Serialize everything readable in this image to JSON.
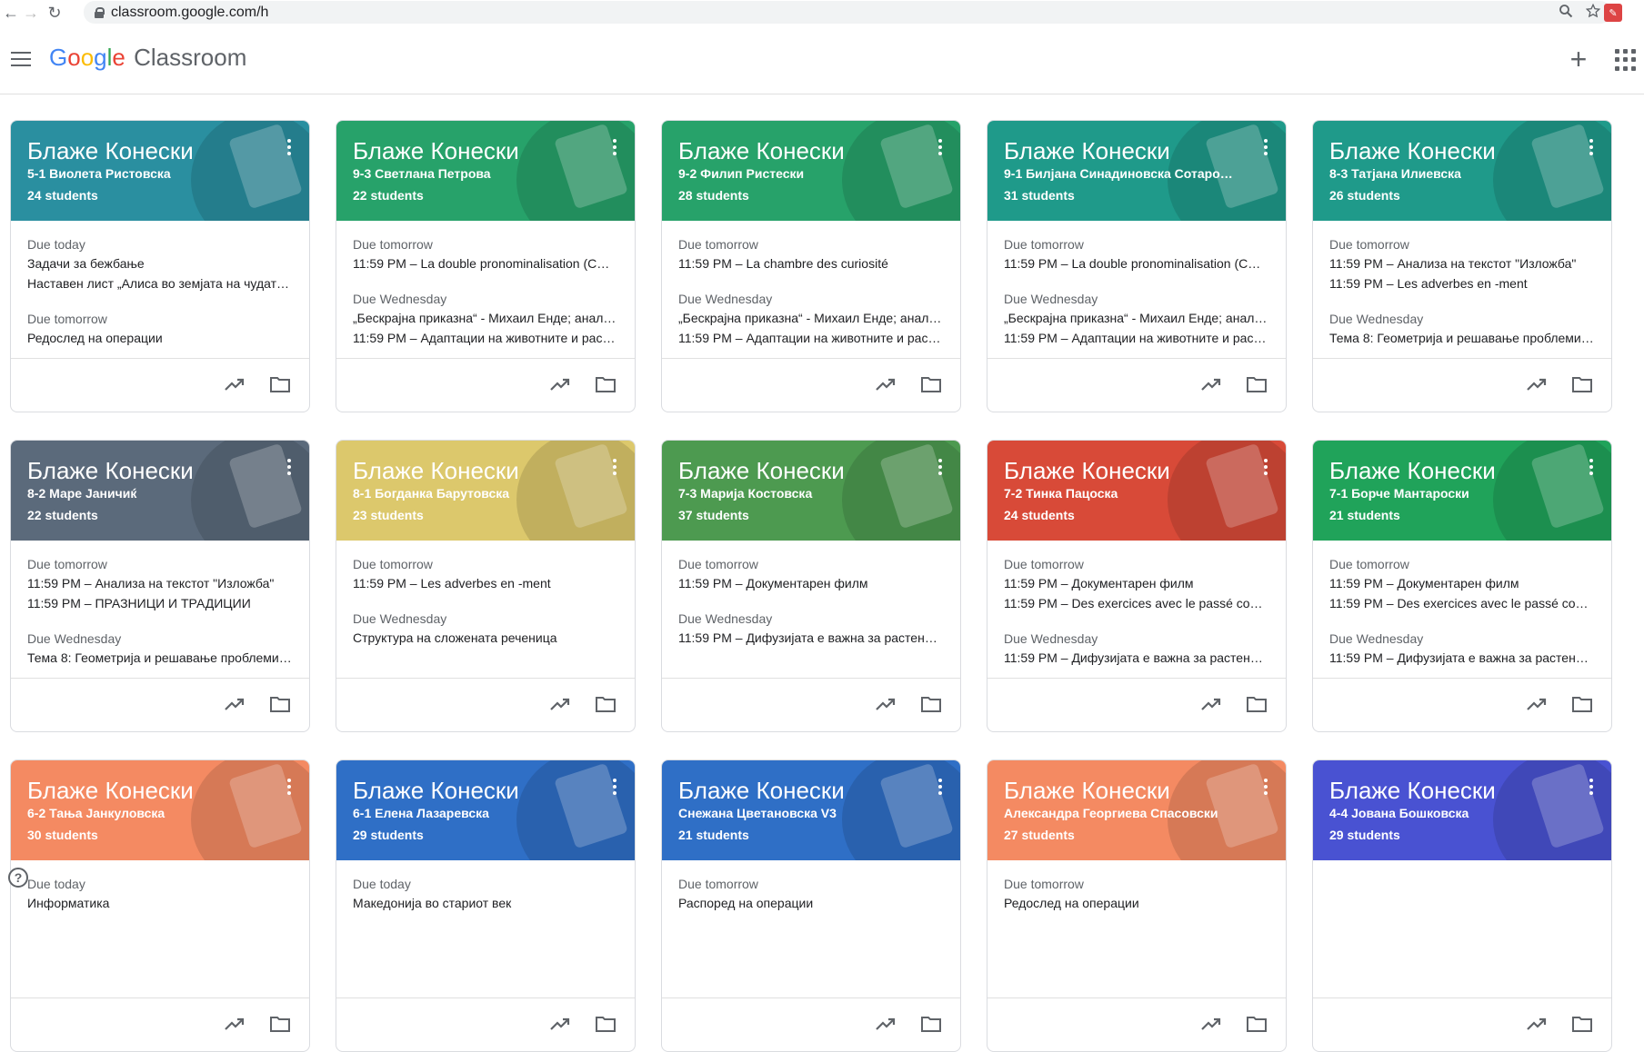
{
  "browser": {
    "url": "classroom.google.com/h"
  },
  "header": {
    "logo_google_letters": [
      "G",
      "o",
      "o",
      "g",
      "l",
      "e"
    ],
    "logo_product": "Classroom"
  },
  "colors": {
    "teal": "#1e8fa0",
    "green": "#24a268",
    "slate": "#5a6c7e",
    "yellow": "#dec86a",
    "leaf": "#4a9a4c",
    "red": "#d84c3a",
    "emerald": "#1ea55f",
    "orange": "#f48a61",
    "blue": "#3271c8",
    "indigo": "#4a55d4"
  },
  "cards": [
    {
      "title": "Блаже Конески",
      "section": "5-1 Виолета Ристовска",
      "students": "24 students",
      "color": "#2a8fa0",
      "groups": [
        {
          "label": "Due today",
          "items": [
            "Задачи за бежбање",
            "Наставен лист „Алиса во земјата на чудат…"
          ]
        },
        {
          "label": "Due tomorrow",
          "items": [
            "Редослед на операции"
          ]
        }
      ]
    },
    {
      "title": "Блаже Конески",
      "section": "9-3 Светлана Петрова",
      "students": "22 students",
      "color": "#27a26a",
      "groups": [
        {
          "label": "Due tomorrow",
          "items": [
            "11:59 PM – La double pronominalisation (C…"
          ]
        },
        {
          "label": "Due Wednesday",
          "items": [
            "„Бескрајна приказна“ - Михаил Енде; анал…",
            "11:59 PM – Адаптации на животните и рас…"
          ]
        }
      ]
    },
    {
      "title": "Блаже Конески",
      "section": "9-2 Филип Ристески",
      "students": "28 students",
      "color": "#27a26a",
      "groups": [
        {
          "label": "Due tomorrow",
          "items": [
            "11:59 PM – La chambre des curiosité"
          ]
        },
        {
          "label": "Due Wednesday",
          "items": [
            "„Бескрајна приказна“ - Михаил Енде; анал…",
            "11:59 PM – Адаптации на животните и рас…"
          ]
        }
      ]
    },
    {
      "title": "Блаже Конески",
      "section": "9-1 Билјана Синадиновска Сотаров…",
      "students": "31 students",
      "color": "#1f9a8a",
      "groups": [
        {
          "label": "Due tomorrow",
          "items": [
            "11:59 PM – La double pronominalisation (C…"
          ]
        },
        {
          "label": "Due Wednesday",
          "items": [
            "„Бескрајна приказна“ - Михаил Енде; анал…",
            "11:59 PM – Адаптации на животните и рас…"
          ]
        }
      ]
    },
    {
      "title": "Блаже Конески",
      "section": "8-3 Татјана Илиевска",
      "students": "26 students",
      "color": "#1f9a8a",
      "groups": [
        {
          "label": "Due tomorrow",
          "items": [
            "11:59 PM – Анализа на текстот \"Изложба\"",
            "11:59 PM – Les adverbes en -ment"
          ]
        },
        {
          "label": "Due Wednesday",
          "items": [
            "Тема 8: Геометрија и решавање проблеми…"
          ]
        }
      ]
    },
    {
      "title": "Блаже Конески",
      "section": "8-2 Маре Јаничиќ",
      "students": "22 students",
      "color": "#5b6a7b",
      "groups": [
        {
          "label": "Due tomorrow",
          "items": [
            "11:59 PM – Анализа на текстот \"Изложба\"",
            "11:59 PM – ПРАЗНИЦИ И ТРАДИЦИИ"
          ]
        },
        {
          "label": "Due Wednesday",
          "items": [
            "Тема 8: Геометрија и решавање проблеми…"
          ]
        }
      ]
    },
    {
      "title": "Блаже Конески",
      "section": "8-1 Богданка Барутовска",
      "students": "23 students",
      "color": "#dcc86c",
      "groups": [
        {
          "label": "Due tomorrow",
          "items": [
            "11:59 PM – Les adverbes en -ment"
          ]
        },
        {
          "label": "Due Wednesday",
          "items": [
            "Структура на сложената реченица"
          ]
        }
      ]
    },
    {
      "title": "Блаже Конески",
      "section": "7-3 Марија Костовска",
      "students": "37 students",
      "color": "#4d9a50",
      "groups": [
        {
          "label": "Due tomorrow",
          "items": [
            "11:59 PM – Документарен филм"
          ]
        },
        {
          "label": "Due Wednesday",
          "items": [
            "11:59 PM – Дифузијата е важна за растен…"
          ]
        }
      ]
    },
    {
      "title": "Блаже Конески",
      "section": "7-2 Тинка Пацоска",
      "students": "24 students",
      "color": "#d84a38",
      "groups": [
        {
          "label": "Due tomorrow",
          "items": [
            "11:59 PM – Документарен филм",
            "11:59 PM – Des exercices avec le passé co…"
          ]
        },
        {
          "label": "Due Wednesday",
          "items": [
            "11:59 PM – Дифузијата е важна за растен…"
          ]
        }
      ]
    },
    {
      "title": "Блаже Конески",
      "section": "7-1 Борче Мантароски",
      "students": "21 students",
      "color": "#20a35a",
      "groups": [
        {
          "label": "Due tomorrow",
          "items": [
            "11:59 PM – Документарен филм",
            "11:59 PM – Des exercices avec le passé co…"
          ]
        },
        {
          "label": "Due Wednesday",
          "items": [
            "11:59 PM – Дифузијата е важна за растен…"
          ]
        }
      ]
    },
    {
      "title": "Блаже Конески",
      "section": "6-2 Тања Јанкуловска",
      "students": "30 students",
      "color": "#f48a62",
      "groups": [
        {
          "label": "Due today",
          "items": [
            "Информатика"
          ]
        }
      ]
    },
    {
      "title": "Блаже Конески",
      "section": "6-1 Елена Лазаревска",
      "students": "29 students",
      "color": "#2f6fc6",
      "groups": [
        {
          "label": "Due today",
          "items": [
            "Македонија во стариот век"
          ]
        }
      ]
    },
    {
      "title": "Блаже Конески",
      "section": "Снежана Цветановска V3",
      "students": "21 students",
      "color": "#2f6fc6",
      "groups": [
        {
          "label": "Due tomorrow",
          "items": [
            "Распоред на операции"
          ]
        }
      ]
    },
    {
      "title": "Блаже Конески",
      "section": "Александра Георгиева Спасовски",
      "students": "27 students",
      "color": "#f48a62",
      "groups": [
        {
          "label": "Due tomorrow",
          "items": [
            "Редослед на операции"
          ]
        }
      ]
    },
    {
      "title": "Блаже Конески",
      "section": "4-4 Јована Бошковска",
      "students": "29 students",
      "color": "#4952d2",
      "groups": []
    }
  ],
  "help": "?"
}
